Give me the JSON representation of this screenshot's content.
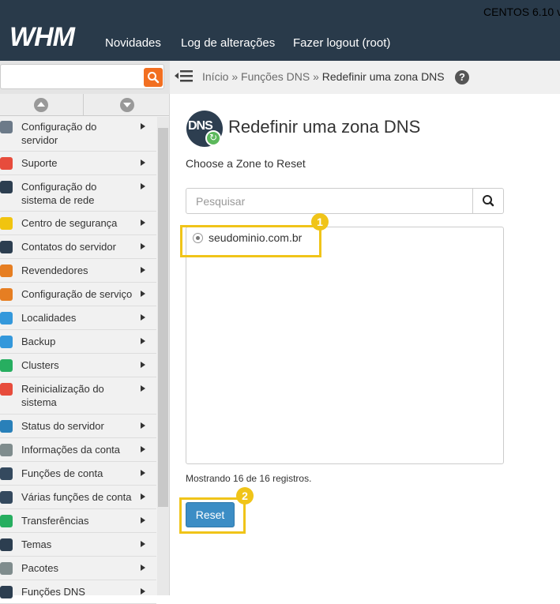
{
  "header": {
    "os_version": "CENTOS 6.10 v",
    "logo": "WHM",
    "nav": [
      "Novidades",
      "Log de alterações",
      "Fazer logout (root)"
    ]
  },
  "breadcrumb": {
    "items": [
      "Início",
      "Funções DNS"
    ],
    "separator": "»",
    "current": "Redefinir uma zona DNS",
    "help": "?"
  },
  "sidebar": {
    "items": [
      {
        "label": "Configuração do\nservidor",
        "icon": "server-config-icon",
        "color": "#6c7a89"
      },
      {
        "label": "Suporte",
        "icon": "support-icon",
        "color": "#e74c3c"
      },
      {
        "label": "Configuração do\nsistema de rede",
        "icon": "network-icon",
        "color": "#2c3e50"
      },
      {
        "label": "Centro de segurança",
        "icon": "lock-icon",
        "color": "#f1c40f"
      },
      {
        "label": "Contatos do servidor",
        "icon": "contacts-icon",
        "color": "#2c3e50"
      },
      {
        "label": "Revendedores",
        "icon": "resellers-icon",
        "color": "#e67e22"
      },
      {
        "label": "Configuração de serviço",
        "icon": "service-config-icon",
        "color": "#e67e22"
      },
      {
        "label": "Localidades",
        "icon": "locales-icon",
        "color": "#3498db"
      },
      {
        "label": "Backup",
        "icon": "backup-icon",
        "color": "#3498db"
      },
      {
        "label": "Clusters",
        "icon": "clusters-icon",
        "color": "#27ae60"
      },
      {
        "label": "Reinicialização do\nsistema",
        "icon": "power-icon",
        "color": "#e74c3c"
      },
      {
        "label": "Status do servidor",
        "icon": "status-icon",
        "color": "#2980b9"
      },
      {
        "label": "Informações da conta",
        "icon": "account-info-icon",
        "color": "#7f8c8d"
      },
      {
        "label": "Funções de conta",
        "icon": "account-functions-icon",
        "color": "#34495e"
      },
      {
        "label": "Várias funções de conta",
        "icon": "multi-account-icon",
        "color": "#34495e"
      },
      {
        "label": "Transferências",
        "icon": "transfers-icon",
        "color": "#27ae60"
      },
      {
        "label": "Temas",
        "icon": "themes-icon",
        "color": "#2c3e50"
      },
      {
        "label": "Pacotes",
        "icon": "packages-icon",
        "color": "#7f8c8d"
      },
      {
        "label": "Funções DNS",
        "icon": "dns-icon",
        "color": "#2c3e50"
      }
    ]
  },
  "main": {
    "icon_text": "DNS",
    "title": "Redefinir uma zona DNS",
    "subtitle": "Choose a Zone to Reset",
    "search_placeholder": "Pesquisar",
    "zones": [
      {
        "name": "seudominio.com.br",
        "selected": true
      }
    ],
    "records": "Mostrando 16 de 16 registros.",
    "reset_label": "Reset",
    "markers": [
      "1",
      "2"
    ]
  },
  "colors": {
    "topbar": "#293a4a",
    "accent": "#f26f21",
    "highlight": "#f0c419",
    "button": "#3c8dc5"
  }
}
